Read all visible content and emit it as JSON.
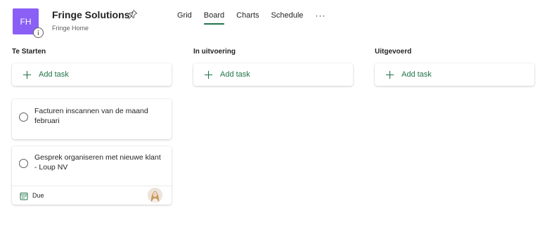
{
  "header": {
    "avatar_initials": "FH",
    "title": "Fringe Solutions",
    "subtitle": "Fringe Home",
    "tabs": [
      {
        "label": "Grid",
        "active": false
      },
      {
        "label": "Board",
        "active": true
      },
      {
        "label": "Charts",
        "active": false
      },
      {
        "label": "Schedule",
        "active": false
      }
    ],
    "more_label": "···"
  },
  "buckets": [
    {
      "title": "Te Starten",
      "add_label": "Add task",
      "tasks": [
        {
          "title": "Facturen inscannen van de maand februari"
        },
        {
          "title": "Gesprek organiseren met nieuwe klant - Loup NV",
          "due_label": "Due"
        }
      ]
    },
    {
      "title": "In uitvoering",
      "add_label": "Add task",
      "tasks": []
    },
    {
      "title": "Uitgevoerd",
      "add_label": "Add task",
      "tasks": []
    }
  ],
  "colors": {
    "accent": "#217346",
    "avatar": "#8a5ff6"
  }
}
